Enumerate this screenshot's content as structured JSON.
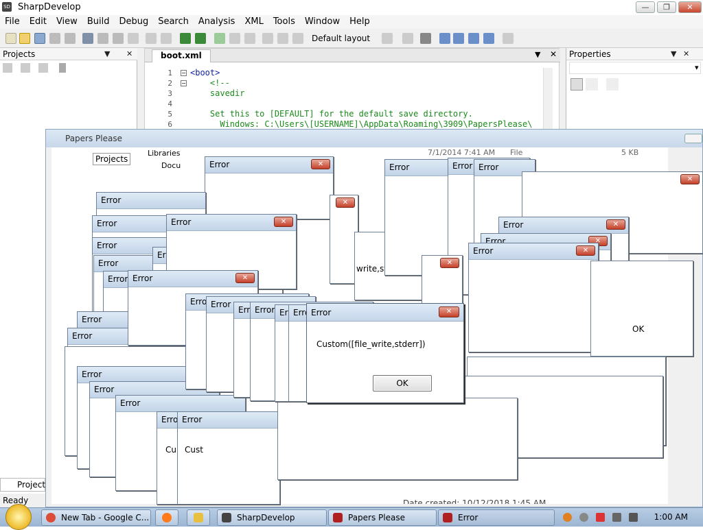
{
  "app": {
    "title": "SharpDevelop",
    "logo": "SD",
    "window_buttons": {
      "minimize": "—",
      "maximize": "❐",
      "close": "✕"
    }
  },
  "menu": [
    "File",
    "Edit",
    "View",
    "Build",
    "Debug",
    "Search",
    "Analysis",
    "XML",
    "Tools",
    "Window",
    "Help"
  ],
  "toolbar": {
    "layout_label": "Default layout",
    "layout_arrow": "▾"
  },
  "projects_pane": {
    "title": "Projects",
    "pin": "▼",
    "close": "✕"
  },
  "properties_pane": {
    "title": "Properties",
    "pin": "▼",
    "close": "✕",
    "dropdown_arrow": "▾"
  },
  "editor": {
    "tab_label": "boot.xml",
    "tab_controls": {
      "pin": "▼",
      "close": "✕"
    },
    "lines": [
      {
        "n": "1",
        "text": "<boot>",
        "fold": "−"
      },
      {
        "n": "2",
        "text": "    <!--",
        "fold": "−"
      },
      {
        "n": "3",
        "text": "    savedir",
        "fold": ""
      },
      {
        "n": "4",
        "text": "",
        "fold": ""
      },
      {
        "n": "5",
        "text": "    Set this to [DEFAULT] for the default save directory.",
        "fold": ""
      },
      {
        "n": "6",
        "text": "      Windows: C:\\Users\\[USERNAME]\\AppData\\Roaming\\3909\\PapersPlease\\",
        "fold": ""
      }
    ]
  },
  "papers_window": {
    "title": "Papers Please",
    "explorer": {
      "tree_items": [
        "Libraries",
        "Docu"
      ],
      "projects_label": "Projects",
      "file_date": "7/1/2014 7:41 AM",
      "file_type": "File",
      "file_size": "5 KB",
      "date_created": "Date created: 10/12/2018 1:45 AM"
    }
  },
  "error_dialog": {
    "title": "Error",
    "message": "Custom([file_write,stderr])",
    "partial_message": "write,stderr])",
    "fragment_cu": "Cu",
    "fragment_cust": "Cust",
    "fragment_ok": "OK",
    "ok_label": "OK",
    "close_glyph": "✕"
  },
  "status": {
    "text": "Ready"
  },
  "bottom_tab": {
    "label": "Projects"
  },
  "taskbar": {
    "items": [
      {
        "label": "New Tab - Google C...",
        "color": "#dd4b39"
      },
      {
        "label": "",
        "color": "#ff7a1a"
      },
      {
        "label": "",
        "color": "#e8c040"
      },
      {
        "label": "SharpDevelop",
        "color": "#444444"
      },
      {
        "label": "Papers Please",
        "color": "#b02020"
      },
      {
        "label": "Error",
        "color": "#b02020"
      }
    ],
    "clock": "1:00 AM"
  }
}
